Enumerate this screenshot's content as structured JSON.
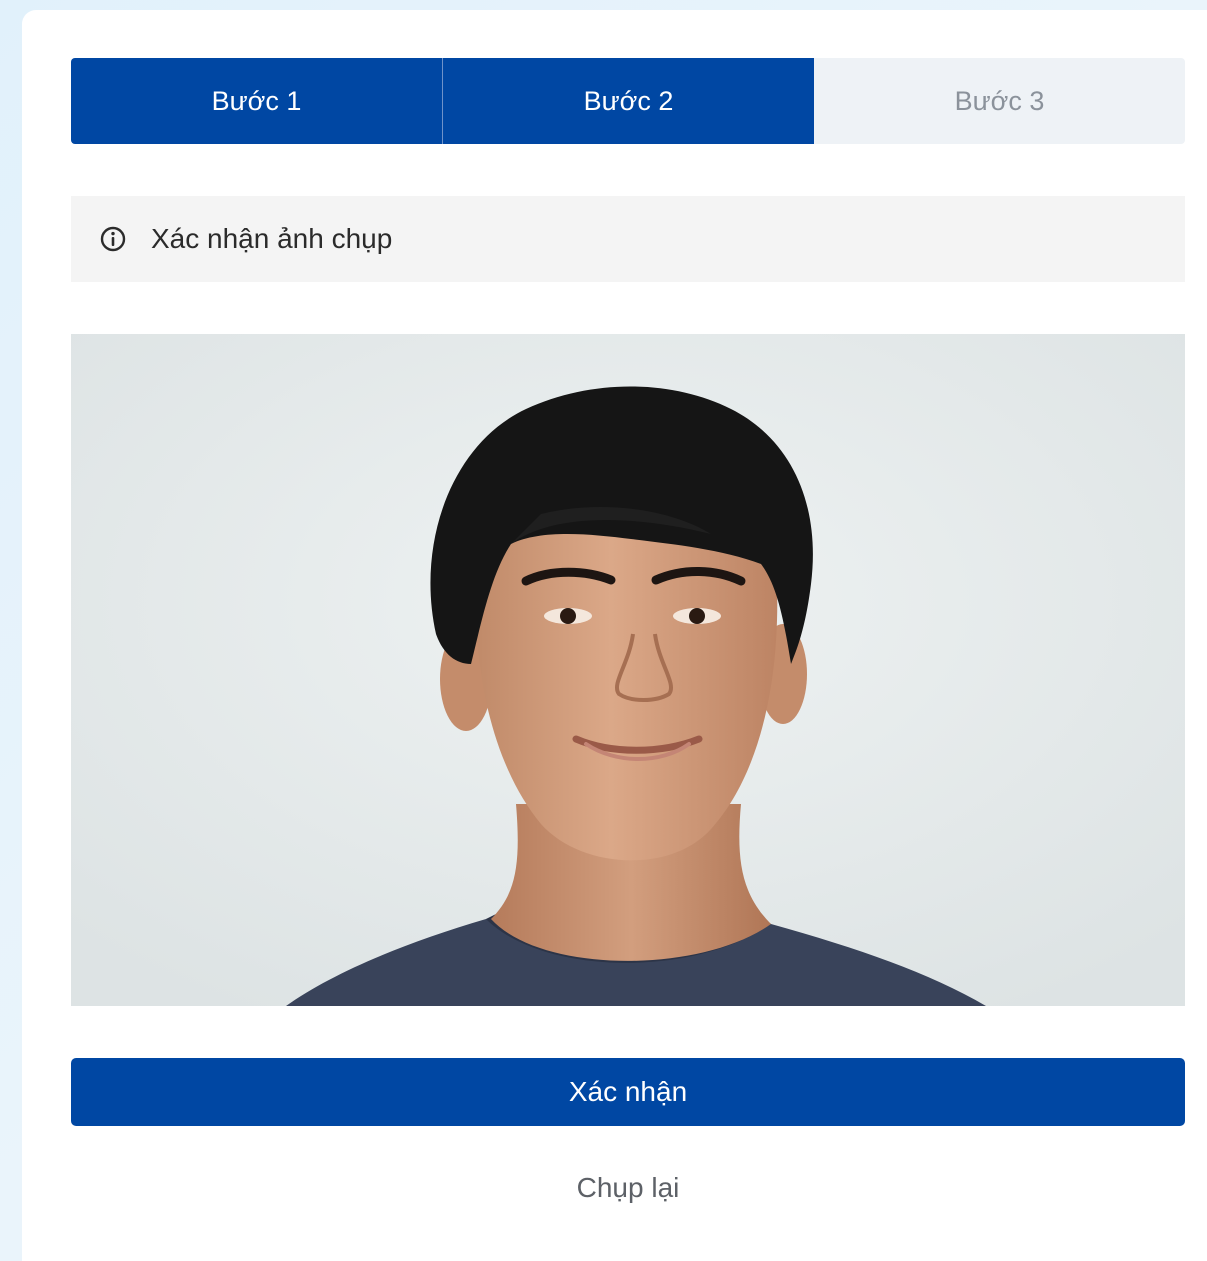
{
  "colors": {
    "primary": "#0047a3",
    "step_inactive_bg": "#eef2f6",
    "notice_bg": "#f4f4f4"
  },
  "stepper": {
    "steps": [
      {
        "label": "Bước 1",
        "state": "done"
      },
      {
        "label": "Bước 2",
        "state": "done"
      },
      {
        "label": "Bước 3",
        "state": "todo"
      }
    ]
  },
  "notice": {
    "icon": "info-icon",
    "text": "Xác nhận ảnh chụp"
  },
  "photo": {
    "subject": "captured-portrait-photo"
  },
  "actions": {
    "confirm_label": "Xác nhận",
    "retake_label": "Chụp lại"
  }
}
